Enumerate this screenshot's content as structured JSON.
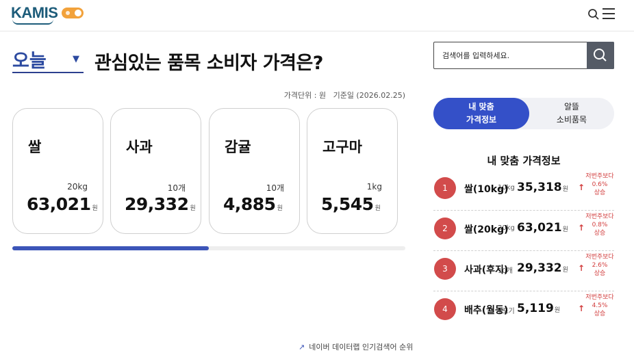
{
  "header": {
    "logo_text": "KAMIS",
    "logo_colors": {
      "primary": "#1d5c7a",
      "accent": "#5aa547"
    },
    "toggle_color": "#f2a23b",
    "icons": [
      "search-icon",
      "menu-icon"
    ]
  },
  "hero": {
    "period_selected": "오늘",
    "title": "관심있는 품목 소비자 가격은?",
    "unit_note": "가격단위 : 원",
    "base_date": "기준일 (2026.02.25)"
  },
  "cards": [
    {
      "name": "쌀",
      "unit": "20kg",
      "price": "63,021",
      "won": "원"
    },
    {
      "name": "사과",
      "unit": "10개",
      "price": "29,332",
      "won": "원"
    },
    {
      "name": "감귤",
      "unit": "10개",
      "price": "4,885",
      "won": "원"
    },
    {
      "name": "고구마",
      "unit": "1kg",
      "price": "5,545",
      "won": "원"
    }
  ],
  "carousel_progress_percent": 50,
  "trend_link": "네이버 데이터랩 인기검색어 순위",
  "search": {
    "placeholder": "검색어를 입력하세요."
  },
  "tabs": [
    {
      "line1": "내 맞춤",
      "line2": "가격정보",
      "active": true
    },
    {
      "line1": "알뜰",
      "line2": "소비품목",
      "active": false
    }
  ],
  "panel_title": "내 맞춤 가격정보",
  "ranking": [
    {
      "rank": "1",
      "name": "쌀(10kg)",
      "unit": "10kg",
      "price": "35,318",
      "won": "원",
      "change_label": "저번주보다",
      "change_pct": "0.6%",
      "direction": "상승"
    },
    {
      "rank": "2",
      "name": "쌀(20kg)",
      "unit": "20kg",
      "price": "63,021",
      "won": "원",
      "change_label": "저번주보다",
      "change_pct": "0.8%",
      "direction": "상승"
    },
    {
      "rank": "3",
      "name": "사과(후지)",
      "unit": "10개",
      "price": "29,332",
      "won": "원",
      "change_label": "저번주보다",
      "change_pct": "2.6%",
      "direction": "상승"
    },
    {
      "rank": "4",
      "name": "배추(월동)",
      "unit": "1포기",
      "price": "5,119",
      "won": "원",
      "change_label": "저번주보다",
      "change_pct": "4.5%",
      "direction": "상승"
    }
  ],
  "colors": {
    "brand_blue": "#3450c8",
    "rank_red": "#d24b4b",
    "rise_red": "#d23c3c"
  }
}
